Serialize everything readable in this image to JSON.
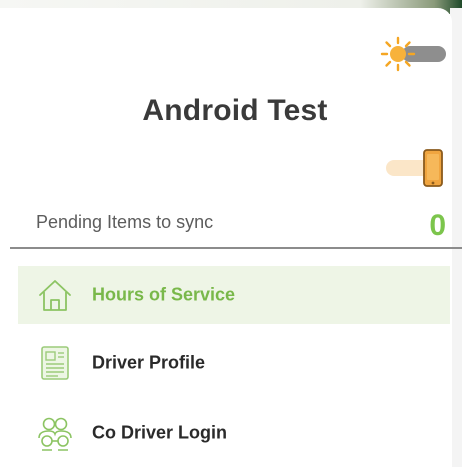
{
  "colors": {
    "accent": "#7cc54c",
    "active_bg": "#eef5e6",
    "toggle_track": "#8e8e8e",
    "toggle_active_track": "#fbe6c8",
    "sun": "#f5a623"
  },
  "drawer": {
    "title": "Android Test",
    "theme_toggle": {
      "icon": "sun-icon",
      "state": "off"
    },
    "orientation_toggle": {
      "icon": "phone-icon",
      "state": "on"
    },
    "pending": {
      "label": "Pending Items to sync",
      "count": "0"
    },
    "menu": [
      {
        "label": "Hours of Service",
        "icon": "home-icon",
        "active": true
      },
      {
        "label": "Driver Profile",
        "icon": "profile-document-icon",
        "active": false
      },
      {
        "label": "Co Driver Login",
        "icon": "co-driver-icon",
        "active": false
      }
    ]
  }
}
